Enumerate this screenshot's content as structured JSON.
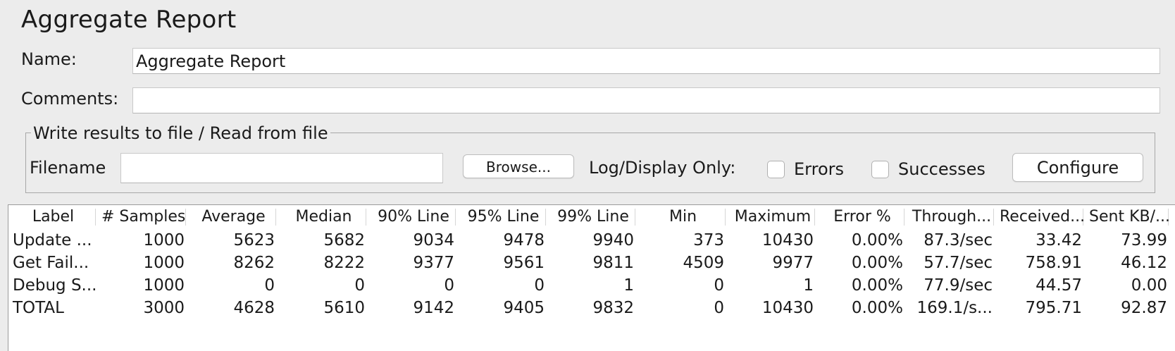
{
  "panel": {
    "title": "Aggregate Report",
    "name_label": "Name:",
    "name_value": "Aggregate Report",
    "comments_label": "Comments:",
    "comments_value": ""
  },
  "file_section": {
    "legend": "Write results to file / Read from file",
    "filename_label": "Filename",
    "filename_value": "",
    "browse_label": "Browse...",
    "log_display_label": "Log/Display Only:",
    "errors_label": "Errors",
    "errors_checked": false,
    "successes_label": "Successes",
    "successes_checked": false,
    "configure_label": "Configure"
  },
  "table": {
    "headers": [
      "Label",
      "# Samples",
      "Average",
      "Median",
      "90% Line",
      "95% Line",
      "99% Line",
      "Min",
      "Maximum",
      "Error %",
      "Through...",
      "Received...",
      "Sent KB/..."
    ],
    "rows": [
      [
        "Update ...",
        "1000",
        "5623",
        "5682",
        "9034",
        "9478",
        "9940",
        "373",
        "10430",
        "0.00%",
        "87.3/sec",
        "33.42",
        "73.99"
      ],
      [
        "Get Fail...",
        "1000",
        "8262",
        "8222",
        "9377",
        "9561",
        "9811",
        "4509",
        "9977",
        "0.00%",
        "57.7/sec",
        "758.91",
        "46.12"
      ],
      [
        "Debug S...",
        "1000",
        "0",
        "0",
        "0",
        "0",
        "1",
        "0",
        "1",
        "0.00%",
        "77.9/sec",
        "44.57",
        "0.00"
      ],
      [
        "TOTAL",
        "3000",
        "4628",
        "5610",
        "9142",
        "9405",
        "9832",
        "0",
        "10430",
        "0.00%",
        "169.1/s...",
        "795.71",
        "92.87"
      ]
    ]
  }
}
